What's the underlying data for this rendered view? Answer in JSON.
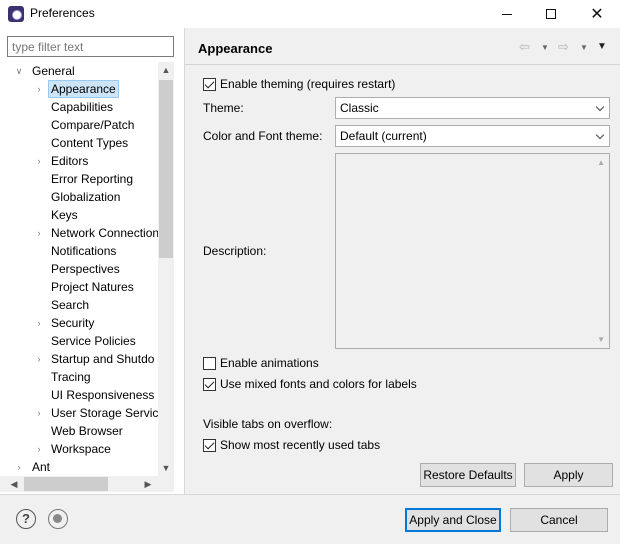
{
  "window": {
    "title": "Preferences",
    "minimize_glyph": "",
    "maximize_glyph": "",
    "close_glyph": "✕"
  },
  "filter": {
    "placeholder": "type filter text",
    "value": ""
  },
  "tree": {
    "items": [
      {
        "label": "General",
        "expanded": true,
        "level": 0,
        "arrow": "∨"
      },
      {
        "label": "Appearance",
        "level": 1,
        "arrow": "›",
        "selected": true
      },
      {
        "label": "Capabilities",
        "level": 1,
        "arrow": ""
      },
      {
        "label": "Compare/Patch",
        "level": 1,
        "arrow": ""
      },
      {
        "label": "Content Types",
        "level": 1,
        "arrow": ""
      },
      {
        "label": "Editors",
        "level": 1,
        "arrow": "›"
      },
      {
        "label": "Error Reporting",
        "level": 1,
        "arrow": ""
      },
      {
        "label": "Globalization",
        "level": 1,
        "arrow": ""
      },
      {
        "label": "Keys",
        "level": 1,
        "arrow": ""
      },
      {
        "label": "Network Connection",
        "level": 1,
        "arrow": "›"
      },
      {
        "label": "Notifications",
        "level": 1,
        "arrow": ""
      },
      {
        "label": "Perspectives",
        "level": 1,
        "arrow": ""
      },
      {
        "label": "Project Natures",
        "level": 1,
        "arrow": ""
      },
      {
        "label": "Search",
        "level": 1,
        "arrow": ""
      },
      {
        "label": "Security",
        "level": 1,
        "arrow": "›"
      },
      {
        "label": "Service Policies",
        "level": 1,
        "arrow": ""
      },
      {
        "label": "Startup and Shutdo",
        "level": 1,
        "arrow": "›"
      },
      {
        "label": "Tracing",
        "level": 1,
        "arrow": ""
      },
      {
        "label": "UI Responsiveness M",
        "level": 1,
        "arrow": ""
      },
      {
        "label": "User Storage Service",
        "level": 1,
        "arrow": "›"
      },
      {
        "label": "Web Browser",
        "level": 1,
        "arrow": ""
      },
      {
        "label": "Workspace",
        "level": 1,
        "arrow": "›"
      },
      {
        "label": "Ant",
        "level": 0,
        "arrow": "›"
      }
    ]
  },
  "page": {
    "title": "Appearance",
    "enable_theming": {
      "label": "Enable theming (requires restart)",
      "checked": true
    },
    "theme": {
      "label": "Theme:",
      "value": "Classic"
    },
    "color_font_theme": {
      "label": "Color and Font theme:",
      "value": "Default (current)"
    },
    "description": {
      "label": "Description:",
      "value": ""
    },
    "enable_animations": {
      "label": "Enable animations",
      "checked": false
    },
    "mixed_fonts": {
      "label": "Use mixed fonts and colors for labels",
      "checked": true
    },
    "visible_tabs": {
      "label": "Visible tabs on overflow:"
    },
    "show_mru": {
      "label": "Show most recently used tabs",
      "checked": true
    },
    "restore_defaults": "Restore Defaults",
    "apply": "Apply"
  },
  "footer": {
    "help_glyph": "?",
    "apply_and_close": "Apply and Close",
    "cancel": "Cancel"
  },
  "icons": {
    "back": "⇦",
    "forward": "⇨",
    "dropdown": "▼",
    "menu": "▼"
  }
}
